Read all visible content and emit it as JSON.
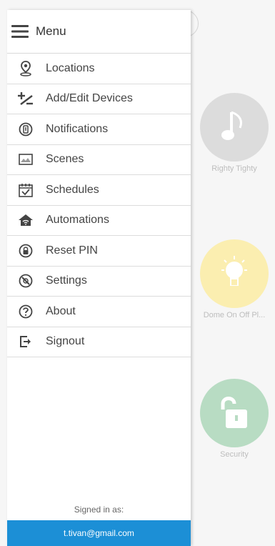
{
  "menu": {
    "title": "Menu",
    "items": [
      {
        "label": "Locations",
        "icon": "location-pin-icon"
      },
      {
        "label": "Add/Edit Devices",
        "icon": "add-edit-icon"
      },
      {
        "label": "Notifications",
        "icon": "notification-icon"
      },
      {
        "label": "Scenes",
        "icon": "image-icon"
      },
      {
        "label": "Schedules",
        "icon": "calendar-icon"
      },
      {
        "label": "Automations",
        "icon": "home-wifi-icon"
      },
      {
        "label": "Reset PIN",
        "icon": "lock-circle-icon"
      },
      {
        "label": "Settings",
        "icon": "settings-icon"
      },
      {
        "label": "About",
        "icon": "help-icon"
      },
      {
        "label": "Signout",
        "icon": "signout-icon"
      }
    ]
  },
  "account": {
    "signed_in_label": "Signed in as:",
    "email": "t.tivan@gmail.com"
  },
  "background_devices": [
    {
      "label": "Righty Tighty"
    },
    {
      "label": "Dome On Off Pl..."
    },
    {
      "label": "Security"
    }
  ],
  "colors": {
    "accent": "#1c8fd6",
    "music": "#dcdcdc",
    "light": "#fbeeb0",
    "lock": "#b8dcc3"
  }
}
